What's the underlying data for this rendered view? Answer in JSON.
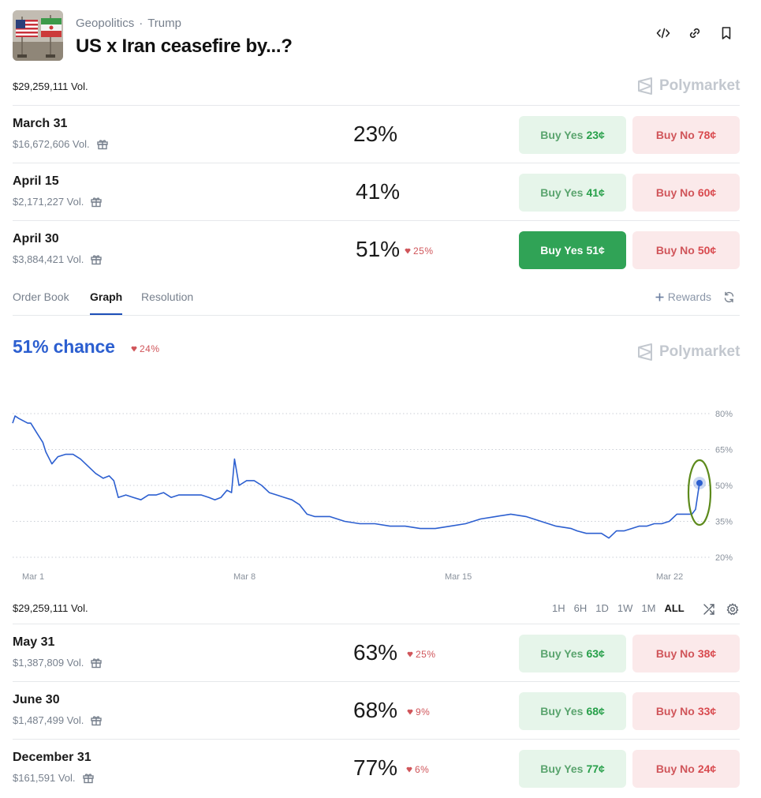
{
  "header": {
    "category": "Geopolitics",
    "subcategory": "Trump",
    "separator": "·",
    "title": "US x Iran ceasefire by...?"
  },
  "total_volume": "$29,259,111 Vol.",
  "brand": "Polymarket",
  "markets_top": [
    {
      "date": "March 31",
      "volume": "$16,672,606 Vol.",
      "percent": "23%",
      "change": "",
      "yes_label": "Buy Yes",
      "yes_price": "23¢",
      "no_label": "Buy No",
      "no_price": "78¢",
      "yes_active": false
    },
    {
      "date": "April 15",
      "volume": "$2,171,227 Vol.",
      "percent": "41%",
      "change": "",
      "yes_label": "Buy Yes",
      "yes_price": "41¢",
      "no_label": "Buy No",
      "no_price": "60¢",
      "yes_active": false
    },
    {
      "date": "April 30",
      "volume": "$3,884,421 Vol.",
      "percent": "51%",
      "change": "25%",
      "yes_label": "Buy Yes",
      "yes_price": "51¢",
      "no_label": "Buy No",
      "no_price": "50¢",
      "yes_active": true
    }
  ],
  "tabs": [
    {
      "label": "Order Book",
      "active": false
    },
    {
      "label": "Graph",
      "active": true
    },
    {
      "label": "Resolution",
      "active": false
    }
  ],
  "rewards_label": "Rewards",
  "chance": {
    "label": "51% chance",
    "change": "24%"
  },
  "chart_data": {
    "type": "line",
    "series": [
      {
        "values": [
          [
            0,
            76
          ],
          [
            0.08,
            79
          ],
          [
            0.2,
            78
          ],
          [
            0.35,
            77
          ],
          [
            0.5,
            76
          ],
          [
            0.6,
            76
          ],
          [
            0.8,
            72
          ],
          [
            1.0,
            68
          ],
          [
            1.1,
            64
          ],
          [
            1.3,
            59
          ],
          [
            1.5,
            62
          ],
          [
            1.75,
            63
          ],
          [
            2.0,
            63
          ],
          [
            2.25,
            61
          ],
          [
            2.5,
            58
          ],
          [
            2.75,
            55
          ],
          [
            3.0,
            53
          ],
          [
            3.2,
            54
          ],
          [
            3.35,
            52
          ],
          [
            3.5,
            45
          ],
          [
            3.75,
            46
          ],
          [
            4.0,
            45
          ],
          [
            4.25,
            44
          ],
          [
            4.5,
            46
          ],
          [
            4.75,
            46
          ],
          [
            5.0,
            47
          ],
          [
            5.25,
            45
          ],
          [
            5.5,
            46
          ],
          [
            5.75,
            46
          ],
          [
            6.0,
            46
          ],
          [
            6.25,
            46
          ],
          [
            6.5,
            45
          ],
          [
            6.7,
            44
          ],
          [
            6.9,
            45
          ],
          [
            7.1,
            48
          ],
          [
            7.25,
            47
          ],
          [
            7.35,
            61
          ],
          [
            7.5,
            50
          ],
          [
            7.75,
            52
          ],
          [
            8.0,
            52
          ],
          [
            8.25,
            50
          ],
          [
            8.5,
            47
          ],
          [
            8.75,
            46
          ],
          [
            9.0,
            45
          ],
          [
            9.25,
            44
          ],
          [
            9.5,
            42
          ],
          [
            9.75,
            38
          ],
          [
            10.0,
            37
          ],
          [
            10.5,
            37
          ],
          [
            11.0,
            35
          ],
          [
            11.5,
            34
          ],
          [
            12.0,
            34
          ],
          [
            12.5,
            33
          ],
          [
            13.0,
            33
          ],
          [
            13.5,
            32
          ],
          [
            14.0,
            32
          ],
          [
            14.5,
            33
          ],
          [
            15.0,
            34
          ],
          [
            15.5,
            36
          ],
          [
            16.0,
            37
          ],
          [
            16.5,
            38
          ],
          [
            17.0,
            37
          ],
          [
            17.5,
            35
          ],
          [
            18.0,
            33
          ],
          [
            18.5,
            32
          ],
          [
            18.7,
            31
          ],
          [
            19.0,
            30
          ],
          [
            19.25,
            30
          ],
          [
            19.5,
            30
          ],
          [
            19.75,
            28
          ],
          [
            20.0,
            31
          ],
          [
            20.25,
            31
          ],
          [
            20.5,
            32
          ],
          [
            20.75,
            33
          ],
          [
            21.0,
            33
          ],
          [
            21.25,
            34
          ],
          [
            21.5,
            34
          ],
          [
            21.75,
            35
          ],
          [
            22.0,
            38
          ],
          [
            22.25,
            38
          ],
          [
            22.5,
            38
          ],
          [
            22.62,
            40
          ],
          [
            22.75,
            51
          ]
        ]
      }
    ],
    "x_ticks": [
      {
        "label": "Mar 1",
        "x": 0
      },
      {
        "label": "Mar 8",
        "x": 7
      },
      {
        "label": "Mar 15",
        "x": 14
      },
      {
        "label": "Mar 22",
        "x": 21
      }
    ],
    "y_ticks": [
      "80%",
      "65%",
      "50%",
      "35%",
      "20%"
    ],
    "ylim": [
      20,
      80
    ],
    "xlim": [
      0,
      22.75
    ],
    "grid": true,
    "line_color": "#2c5fd0"
  },
  "time_ranges": [
    {
      "label": "1H",
      "active": false
    },
    {
      "label": "6H",
      "active": false
    },
    {
      "label": "1D",
      "active": false
    },
    {
      "label": "1W",
      "active": false
    },
    {
      "label": "1M",
      "active": false
    },
    {
      "label": "ALL",
      "active": true
    }
  ],
  "markets_bottom": [
    {
      "date": "May 31",
      "volume": "$1,387,809 Vol.",
      "percent": "63%",
      "change": "25%",
      "yes_label": "Buy Yes",
      "yes_price": "63¢",
      "no_label": "Buy No",
      "no_price": "38¢",
      "yes_active": false
    },
    {
      "date": "June 30",
      "volume": "$1,487,499 Vol.",
      "percent": "68%",
      "change": "9%",
      "yes_label": "Buy Yes",
      "yes_price": "68¢",
      "no_label": "Buy No",
      "no_price": "33¢",
      "yes_active": false
    },
    {
      "date": "December 31",
      "volume": "$161,591 Vol.",
      "percent": "77%",
      "change": "6%",
      "yes_label": "Buy Yes",
      "yes_price": "77¢",
      "no_label": "Buy No",
      "no_price": "24¢",
      "yes_active": false
    }
  ]
}
